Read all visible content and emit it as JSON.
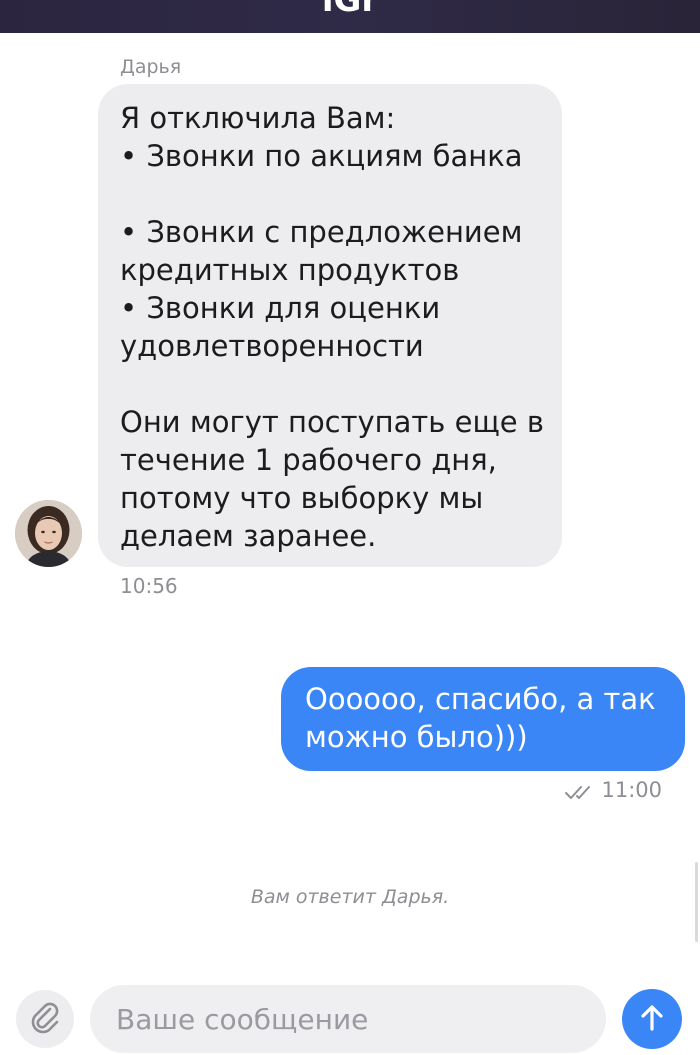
{
  "header": {
    "title": "iGr"
  },
  "chat": {
    "incoming": {
      "sender": "Дарья",
      "lines": [
        "Я отключила Вам:",
        "• Звонки по акциям банка",
        "",
        "• Звонки с предложением",
        "кредитных продуктов",
        "• Звонки для оценки",
        "удовлетворенности",
        "",
        "Они могут поступать еще в",
        "течение 1 рабочего дня,",
        "потому что выборку мы",
        "делаем заранее."
      ],
      "time": "10:56",
      "avatar_icon": "person-avatar-icon"
    },
    "outgoing": {
      "lines": [
        "Оооооо, спасибо, а так",
        "можно было)))"
      ],
      "time": "11:00",
      "status_icon": "double-check-icon"
    },
    "system_note": "Вам ответит Дарья."
  },
  "composer": {
    "placeholder": "Ваше сообщение",
    "value": "",
    "attach_icon": "paperclip-icon",
    "send_icon": "arrow-up-icon"
  },
  "colors": {
    "header_bg": "#2d2744",
    "incoming_bubble": "#ededf0",
    "outgoing_bubble": "#3b86f7",
    "muted_text": "#8e8e93"
  }
}
